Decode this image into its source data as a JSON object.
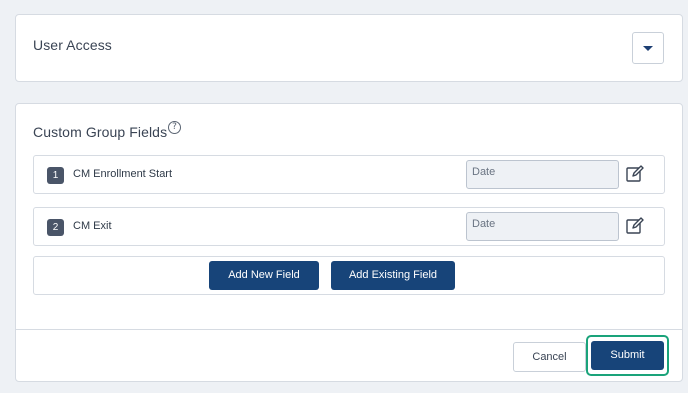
{
  "user_access": {
    "title": "User Access",
    "dropdown_icon": "chevron-down-icon"
  },
  "custom_group_fields": {
    "title": "Custom Group Fields",
    "help_icon": "question-circle-icon",
    "help_glyph": "?",
    "fields": [
      {
        "index": "1",
        "name": "CM Enrollment Start",
        "type": "Date",
        "edit_icon": "edit-icon"
      },
      {
        "index": "2",
        "name": "CM Exit",
        "type": "Date",
        "edit_icon": "edit-icon"
      }
    ],
    "add_new_label": "Add New Field",
    "add_existing_label": "Add Existing Field"
  },
  "footer": {
    "cancel_label": "Cancel",
    "submit_label": "Submit"
  },
  "colors": {
    "primary": "#174479",
    "focus_ring": "#1aa37a",
    "background": "#eef1f5"
  }
}
